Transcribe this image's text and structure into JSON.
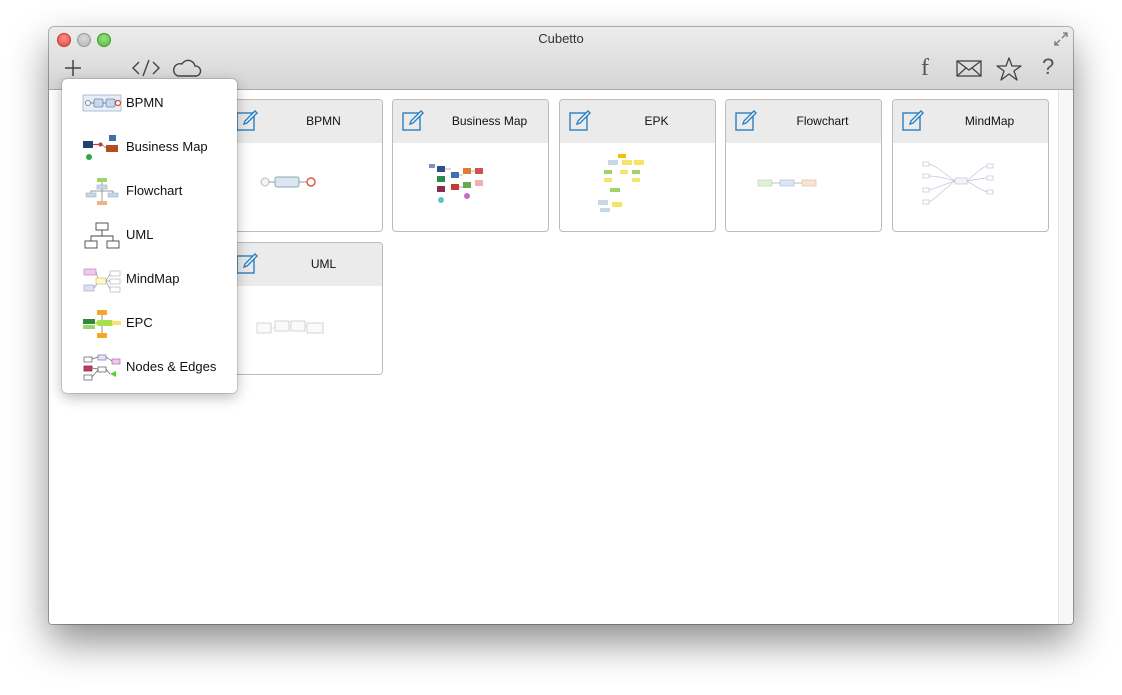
{
  "window": {
    "title": "Cubetto"
  },
  "toolbar": {
    "icons": [
      "plus-icon",
      "code-icon",
      "cloud-icon",
      "facebook-icon",
      "mail-icon",
      "star-icon",
      "help-icon"
    ],
    "facebook_glyph": "f",
    "help_glyph": "?"
  },
  "cards": [
    {
      "title": "BPMN"
    },
    {
      "title": "Business Map"
    },
    {
      "title": "EPK"
    },
    {
      "title": "Flowchart"
    },
    {
      "title": "MindMap"
    },
    {
      "title": "UML"
    }
  ],
  "new_menu": {
    "items": [
      {
        "label": "BPMN"
      },
      {
        "label": "Business Map"
      },
      {
        "label": "Flowchart"
      },
      {
        "label": "UML"
      },
      {
        "label": "MindMap"
      },
      {
        "label": "EPC"
      },
      {
        "label": "Nodes & Edges"
      }
    ]
  },
  "colors": {
    "accent_blue": "#2a7fc0",
    "card_header": "#ebebeb",
    "traffic_close": "#e2463c",
    "traffic_max": "#4dbd38"
  }
}
